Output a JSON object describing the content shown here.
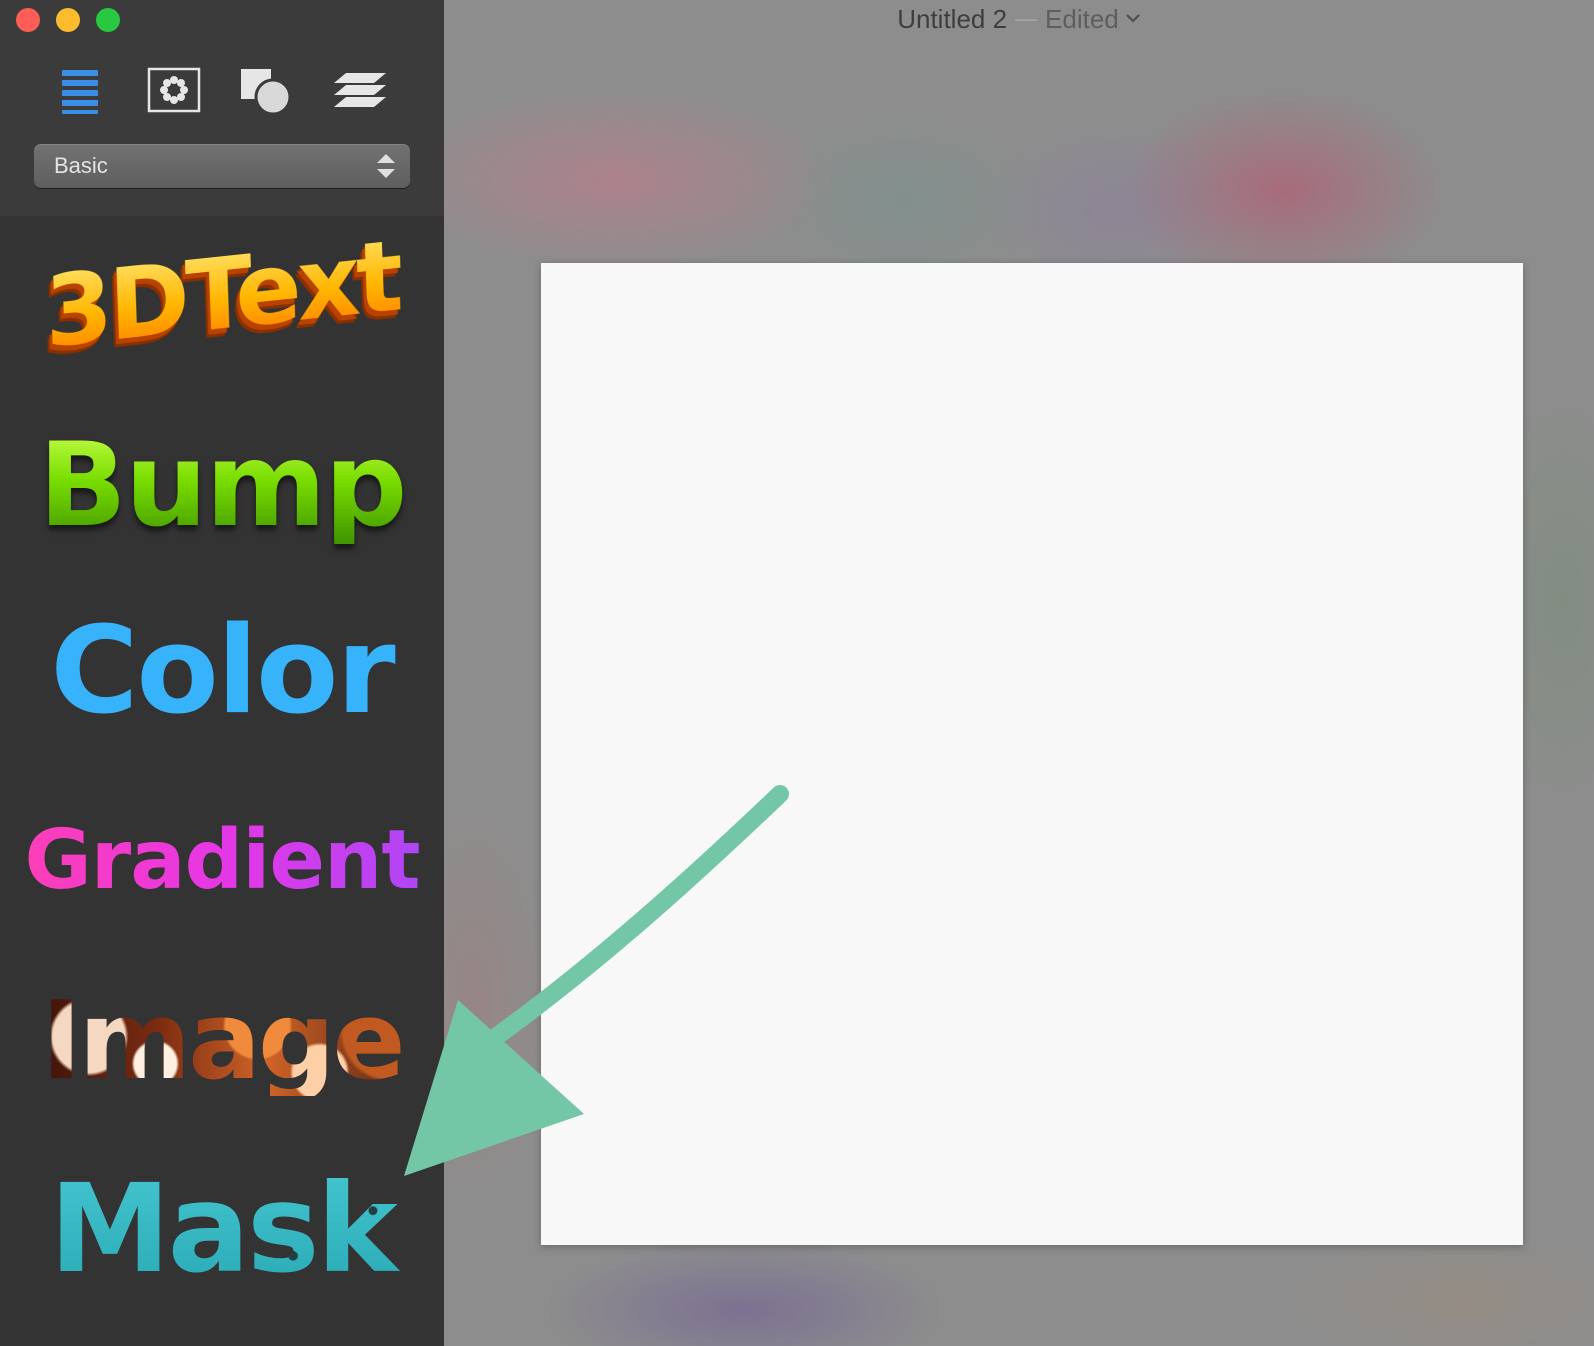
{
  "window": {
    "title": "Untitled 2",
    "separator": "—",
    "status": "Edited"
  },
  "toolbar": {
    "icons": [
      "list-icon",
      "effects-icon",
      "shapes-icon",
      "layers-icon"
    ]
  },
  "preset_select": {
    "value": "Basic"
  },
  "styles": [
    {
      "label": "3DText"
    },
    {
      "label": "Bump"
    },
    {
      "label": "Color"
    },
    {
      "label": "Gradient"
    },
    {
      "label": "Image"
    },
    {
      "label": "Mask"
    }
  ],
  "colors": {
    "sidebar": "#333333",
    "accent_blue": "#3a8ee6",
    "annotation_arrow": "#73c6a6",
    "color_style": "#37b3fb"
  }
}
